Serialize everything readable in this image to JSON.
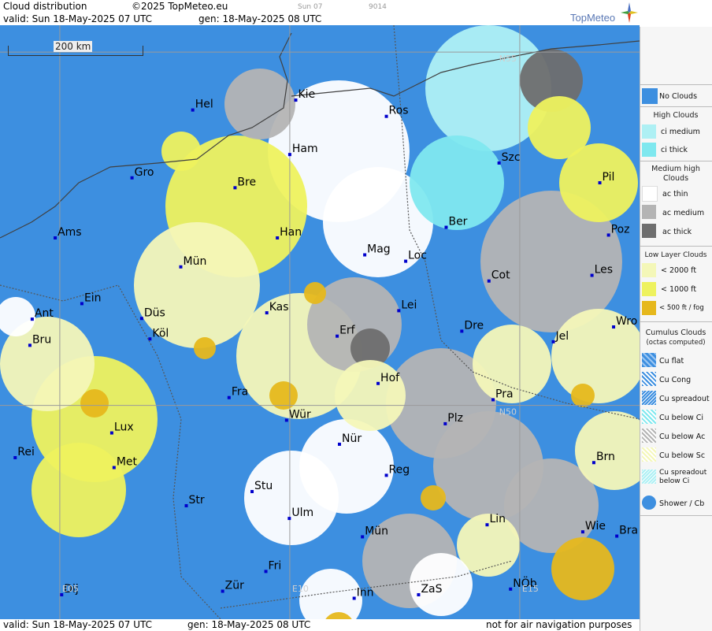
{
  "header": {
    "title": "Cloud distribution",
    "copyright": "©2025 TopMeteo.eu",
    "faint_day": "Sun 07",
    "faint_code": "9014",
    "valid": "valid:  Sun  18-May-2025  07 UTC",
    "gen": "gen: 18-May-2025 08 UTC",
    "logo": "TopMeteo"
  },
  "footer": {
    "valid": "valid:  Sun  18-May-2025  07 UTC",
    "gen": "gen: 18-May-2025 08 UTC",
    "disclaimer": "not for air navigation purposes"
  },
  "scale": "200 km",
  "grid_labels": [
    "N55",
    "N50",
    "E05",
    "E10",
    "E15"
  ],
  "colors": {
    "no_clouds": "#3d8fe0",
    "ci_medium": "#aef0f4",
    "ci_thick": "#7fe8ef",
    "ac_thin": "#ffffff",
    "ac_medium": "#b4b4b4",
    "ac_thick": "#6e6e6e",
    "low_2000": "#f4f7b8",
    "low_1000": "#eef25e",
    "low_500": "#e6b81c",
    "city": "#0000cc"
  },
  "cities": [
    {
      "name": "Kie",
      "lon": 10.13,
      "lat": 54.32
    },
    {
      "name": "Ros",
      "lon": 12.1,
      "lat": 54.09
    },
    {
      "name": "Hel",
      "lon": 7.89,
      "lat": 54.18
    },
    {
      "name": "Ham",
      "lon": 10.0,
      "lat": 53.55
    },
    {
      "name": "Szc",
      "lon": 14.55,
      "lat": 53.43
    },
    {
      "name": "Gro",
      "lon": 6.57,
      "lat": 53.22
    },
    {
      "name": "Bre",
      "lon": 8.81,
      "lat": 53.08
    },
    {
      "name": "Pil",
      "lon": 16.74,
      "lat": 53.15
    },
    {
      "name": "Ber",
      "lon": 13.4,
      "lat": 52.52
    },
    {
      "name": "Ams",
      "lon": 4.9,
      "lat": 52.37
    },
    {
      "name": "Han",
      "lon": 9.73,
      "lat": 52.37
    },
    {
      "name": "Poz",
      "lon": 16.93,
      "lat": 52.41
    },
    {
      "name": "Mag",
      "lon": 11.63,
      "lat": 52.13
    },
    {
      "name": "Loc",
      "lon": 12.52,
      "lat": 52.04
    },
    {
      "name": "Mün",
      "lon": 7.63,
      "lat": 51.96
    },
    {
      "name": "Cot",
      "lon": 14.33,
      "lat": 51.76
    },
    {
      "name": "Les",
      "lon": 16.57,
      "lat": 51.84
    },
    {
      "name": "Ein",
      "lon": 5.48,
      "lat": 51.44
    },
    {
      "name": "Kas",
      "lon": 9.5,
      "lat": 51.31
    },
    {
      "name": "Lei",
      "lon": 12.37,
      "lat": 51.34
    },
    {
      "name": "Ant",
      "lon": 4.4,
      "lat": 51.22
    },
    {
      "name": "Düs",
      "lon": 6.78,
      "lat": 51.23
    },
    {
      "name": "Wro",
      "lon": 17.04,
      "lat": 51.11
    },
    {
      "name": "Dre",
      "lon": 13.74,
      "lat": 51.05
    },
    {
      "name": "Bru",
      "lon": 4.35,
      "lat": 50.85
    },
    {
      "name": "Erf",
      "lon": 11.03,
      "lat": 50.98
    },
    {
      "name": "Köl",
      "lon": 6.96,
      "lat": 50.94
    },
    {
      "name": "Jel",
      "lon": 15.73,
      "lat": 50.9
    },
    {
      "name": "Hof",
      "lon": 11.92,
      "lat": 50.31
    },
    {
      "name": "Fra",
      "lon": 8.68,
      "lat": 50.11
    },
    {
      "name": "Pra",
      "lon": 14.42,
      "lat": 50.08
    },
    {
      "name": "Würz",
      "label": "Wür",
      "lon": 9.93,
      "lat": 49.79
    },
    {
      "name": "Plz",
      "lon": 13.38,
      "lat": 49.74
    },
    {
      "name": "Lux",
      "lon": 6.13,
      "lat": 49.61
    },
    {
      "name": "Nür",
      "lon": 11.08,
      "lat": 49.45
    },
    {
      "name": "Rei",
      "lon": 4.03,
      "lat": 49.26
    },
    {
      "name": "Met",
      "lon": 6.18,
      "lat": 49.12
    },
    {
      "name": "Reg",
      "lon": 12.1,
      "lat": 49.01
    },
    {
      "name": "Brn",
      "lon": 16.61,
      "lat": 49.19
    },
    {
      "name": "Str",
      "lon": 7.75,
      "lat": 48.58
    },
    {
      "name": "Stu",
      "lon": 9.18,
      "lat": 48.78
    },
    {
      "name": "Ulm",
      "lon": 9.99,
      "lat": 48.4
    },
    {
      "name": "Lin",
      "lon": 14.29,
      "lat": 48.31
    },
    {
      "name": "MünS",
      "label": "Mün",
      "lon": 11.58,
      "lat": 48.14
    },
    {
      "name": "Wie",
      "lon": 16.37,
      "lat": 48.21
    },
    {
      "name": "Bra",
      "lon": 17.11,
      "lat": 48.15
    },
    {
      "name": "Fri",
      "lon": 9.48,
      "lat": 47.65
    },
    {
      "name": "Dij",
      "lon": 5.04,
      "lat": 47.32
    },
    {
      "name": "Zür",
      "lon": 8.54,
      "lat": 47.37
    },
    {
      "name": "Inn",
      "lon": 11.4,
      "lat": 47.27
    },
    {
      "name": "ZaS",
      "lon": 12.8,
      "lat": 47.32
    },
    {
      "name": "NÖb",
      "lon": 14.8,
      "lat": 47.4
    }
  ],
  "legend": {
    "no_clouds": "No Clouds",
    "high_head": "High Clouds",
    "ci_medium": "ci medium",
    "ci_thick": "ci thick",
    "med_head": "Medium high Clouds",
    "ac_thin": "ac thin",
    "ac_medium": "ac medium",
    "ac_thick": "ac thick",
    "low_head": "Low Layer Clouds",
    "low_2000": "< 2000 ft",
    "low_1000": "< 1000 ft",
    "low_500": "< 500 ft / fog",
    "cu_head": "Cumulus Clouds",
    "cu_sub": "(octas computed)",
    "cu_flat": "Cu flat",
    "cu_cong": "Cu Cong",
    "cu_spread": "Cu spreadout",
    "cu_below_ci": "Cu below Ci",
    "cu_below_ac": "Cu below Ac",
    "cu_below_sc": "Cu below Sc",
    "cu_spread_ci_1": "Cu spreadout",
    "cu_spread_ci_2": "below Ci",
    "shower": "Shower / Cb"
  }
}
